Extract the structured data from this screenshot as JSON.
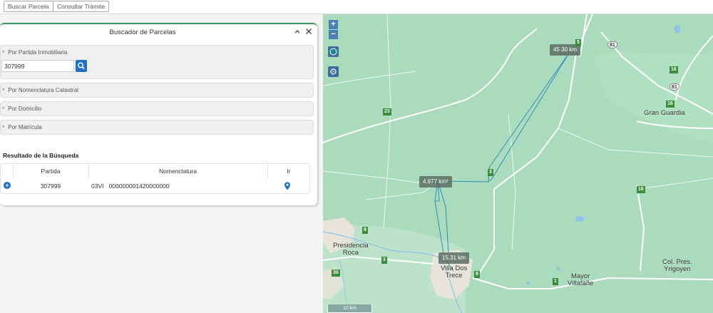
{
  "toolbar": {
    "buscar_parcela": "Buscar Parcela",
    "consultar_tramite": "Consultar Trámite"
  },
  "panel": {
    "title": "Buscador de Parcelas",
    "sections": {
      "partida": "Por Partida Inmobiliaria",
      "nomenclatura": "Por Nomenclatura Catastral",
      "domicilio": "Por Domicilio",
      "matricula": "Por Matrícula"
    },
    "search": {
      "value": "307999"
    },
    "result_title": "Resultado de la Búsqueda",
    "table": {
      "headers": [
        "Partida",
        "Nomenclatura",
        "Ir"
      ],
      "rows": [
        {
          "partida": "307999",
          "nomenclatura": "03VI   000000001420000000"
        }
      ]
    }
  },
  "map": {
    "zoom_in": "+",
    "zoom_out": "−",
    "measurements": [
      "45.30 km",
      "4.977 km²",
      "15.31 km"
    ],
    "places": {
      "gran_guardia": "Gran Guardia",
      "presidencia_roca": "Presidencia\nRoca",
      "villa_dos_trece": "Villa Dos\nTrece",
      "mayor_villafane": "Mayor\nVillafañe",
      "col_pres_yrigoyen": "Col. Pres.\nYrigoyen",
      "ibarreta": "Ibarreta"
    },
    "routes": [
      "81",
      "81",
      "16",
      "16",
      "16",
      "23",
      "3",
      "9",
      "3",
      "30",
      "9",
      "1",
      "5"
    ],
    "scale_label": "10 km",
    "colors": {
      "land": "#a9dbbc",
      "line": "#2f8fbd",
      "route_badge": "#3b8d3b",
      "accent": "#1e6fc6"
    }
  }
}
